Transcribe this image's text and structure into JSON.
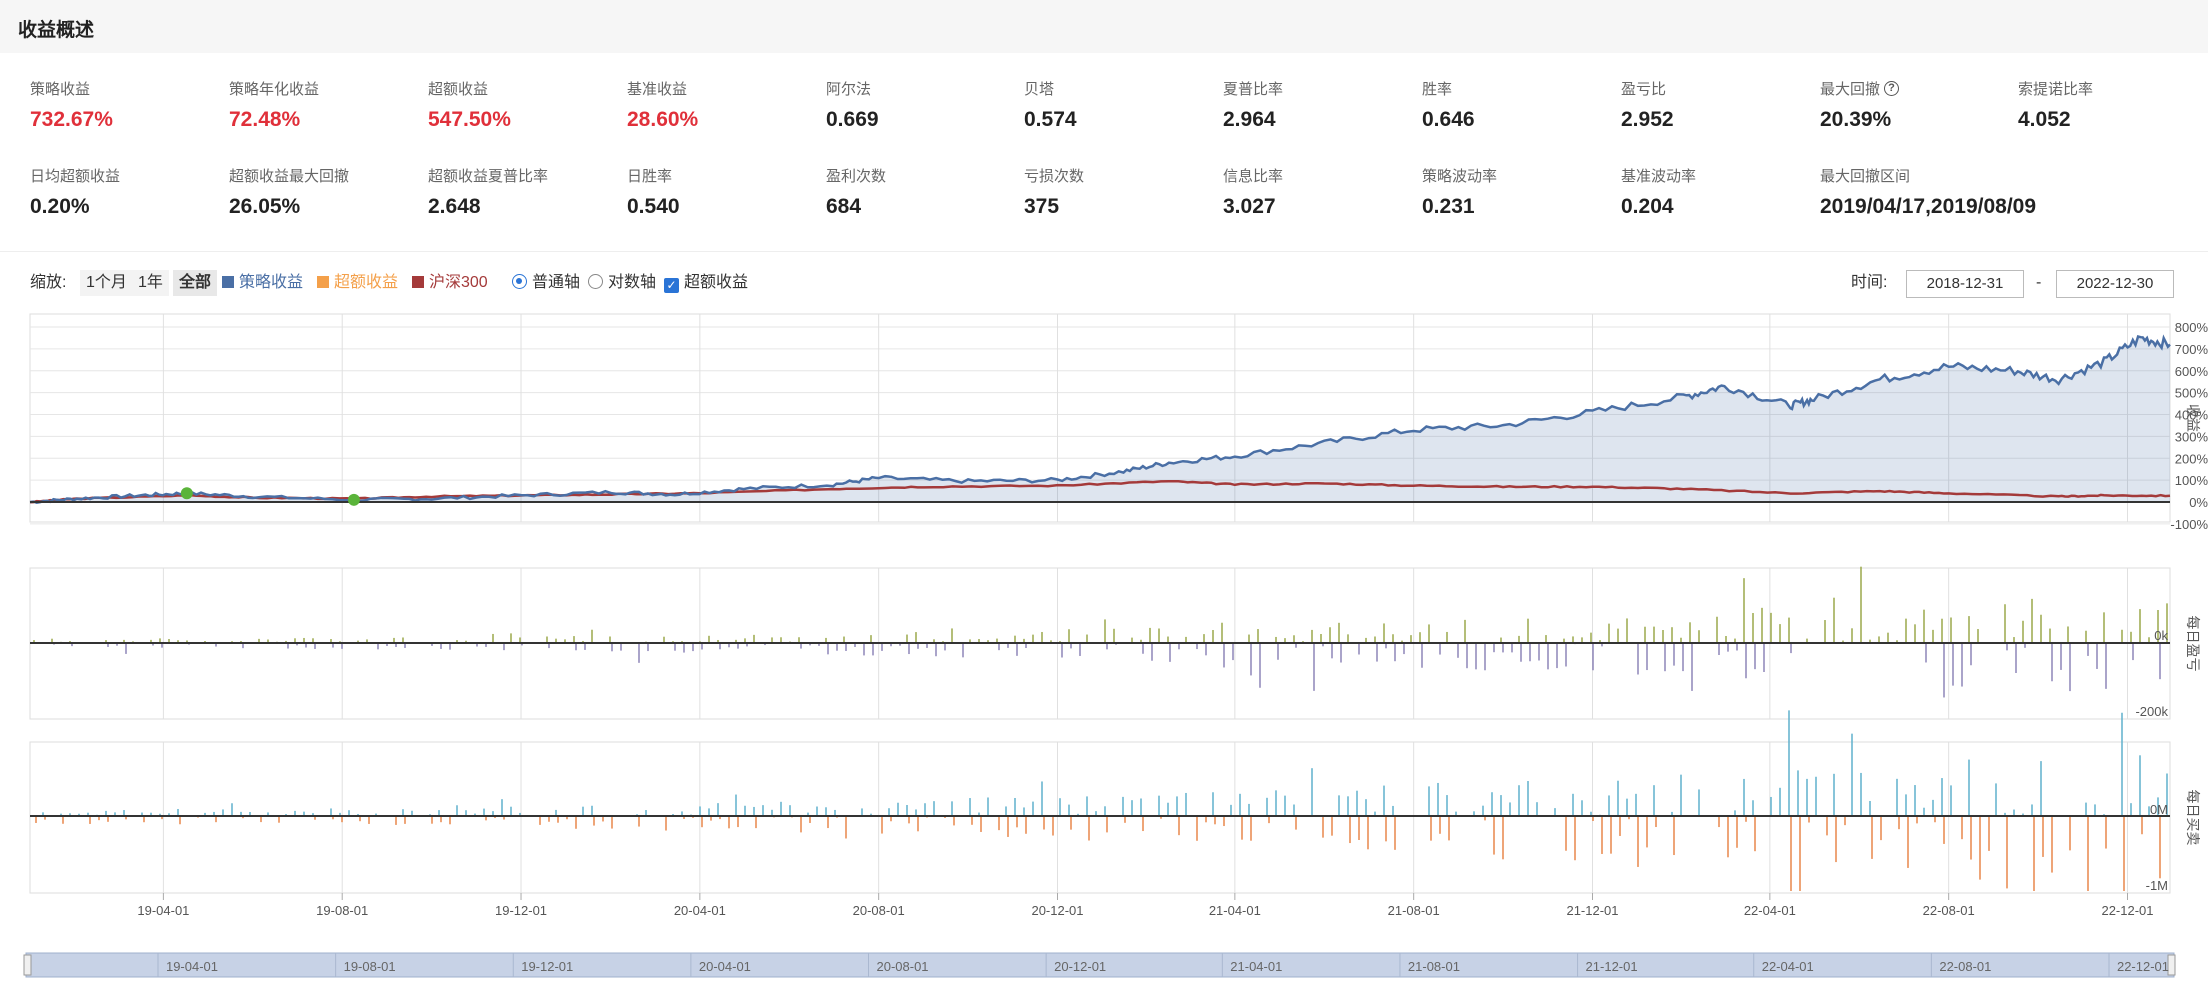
{
  "header": {
    "title": "收益概述"
  },
  "metrics_row1": [
    {
      "label": "策略收益",
      "value": "732.67%",
      "red": true
    },
    {
      "label": "策略年化收益",
      "value": "72.48%",
      "red": true
    },
    {
      "label": "超额收益",
      "value": "547.50%",
      "red": true
    },
    {
      "label": "基准收益",
      "value": "28.60%",
      "red": true
    },
    {
      "label": "阿尔法",
      "value": "0.669",
      "red": false
    },
    {
      "label": "贝塔",
      "value": "0.574",
      "red": false
    },
    {
      "label": "夏普比率",
      "value": "2.964",
      "red": false
    },
    {
      "label": "胜率",
      "value": "0.646",
      "red": false
    },
    {
      "label": "盈亏比",
      "value": "2.952",
      "red": false
    },
    {
      "label": "最大回撤",
      "value": "20.39%",
      "red": false,
      "help": true
    },
    {
      "label": "索提诺比率",
      "value": "4.052",
      "red": false
    }
  ],
  "metrics_row2": [
    {
      "label": "日均超额收益",
      "value": "0.20%"
    },
    {
      "label": "超额收益最大回撤",
      "value": "26.05%"
    },
    {
      "label": "超额收益夏普比率",
      "value": "2.648"
    },
    {
      "label": "日胜率",
      "value": "0.540"
    },
    {
      "label": "盈利次数",
      "value": "684"
    },
    {
      "label": "亏损次数",
      "value": "375"
    },
    {
      "label": "信息比率",
      "value": "3.027"
    },
    {
      "label": "策略波动率",
      "value": "0.231"
    },
    {
      "label": "基准波动率",
      "value": "0.204"
    },
    {
      "label": "最大回撤区间",
      "value": "2019/04/17,2019/08/09"
    }
  ],
  "help_glyph": "?",
  "toolbar": {
    "zoom_label": "缩放:",
    "zoom_1m": "1个月",
    "zoom_1y": "1年",
    "zoom_all": "全部",
    "legend_strategy": "策略收益",
    "legend_excess": "超额收益",
    "legend_benchmark": "沪深300",
    "axis_normal": "普通轴",
    "axis_log": "对数轴",
    "excess_checkbox": "超额收益",
    "check_glyph": "✓",
    "time_label": "时间:",
    "start_date": "2018-12-31",
    "date_sep": "-",
    "end_date": "2022-12-30"
  },
  "colors": {
    "strategy": "#4a6fa5",
    "excess": "#f4a04a",
    "benchmark": "#a43a3a",
    "profit_bar": "#9aa84a",
    "loss_bar": "#8e86b8",
    "buy_bar": "#5fb0cc",
    "sell_bar": "#e8874a",
    "marker": "#5ab43a"
  },
  "chart_data": [
    {
      "type": "area",
      "ylabel": "收益",
      "y_ticks": [
        "800%",
        "700%",
        "600%",
        "500%",
        "400%",
        "300%",
        "200%",
        "100%",
        "0%",
        "-100%"
      ],
      "ylim": [
        -100,
        800
      ],
      "x_ticks": [
        "19-04-01",
        "19-08-01",
        "19-12-01",
        "20-04-01",
        "20-08-01",
        "20-12-01",
        "21-04-01",
        "21-08-01",
        "21-12-01",
        "22-04-01",
        "22-08-01",
        "22-12-01"
      ],
      "x_range": [
        "2018-12-31",
        "2022-12-30"
      ],
      "series": [
        {
          "name": "策略收益",
          "x": [
            "2018-12-31",
            "2019-02-01",
            "2019-03-15",
            "2019-04-17",
            "2019-06-01",
            "2019-08-09",
            "2019-10-01",
            "2019-12-01",
            "2020-02-01",
            "2020-03-15",
            "2020-05-01",
            "2020-07-01",
            "2020-08-01",
            "2020-10-01",
            "2020-12-01",
            "2021-01-15",
            "2021-02-15",
            "2021-04-01",
            "2021-06-01",
            "2021-08-01",
            "2021-10-01",
            "2021-12-01",
            "2022-02-01",
            "2022-03-01",
            "2022-04-15",
            "2022-05-01",
            "2022-06-15",
            "2022-08-01",
            "2022-09-15",
            "2022-10-15",
            "2022-11-15",
            "2022-12-10",
            "2022-12-30"
          ],
          "y": [
            0,
            15,
            30,
            40,
            25,
            10,
            15,
            30,
            45,
            35,
            60,
            80,
            110,
            95,
            100,
            140,
            180,
            210,
            270,
            330,
            350,
            410,
            480,
            530,
            440,
            470,
            560,
            620,
            600,
            560,
            640,
            750,
            720
          ]
        },
        {
          "name": "沪深300",
          "x": [
            "2018-12-31",
            "2019-02-01",
            "2019-04-17",
            "2019-06-01",
            "2019-08-09",
            "2019-10-01",
            "2019-12-01",
            "2020-02-01",
            "2020-04-01",
            "2020-07-01",
            "2020-09-01",
            "2020-12-01",
            "2021-02-15",
            "2021-04-01",
            "2021-06-01",
            "2021-08-01",
            "2021-10-01",
            "2021-12-01",
            "2022-02-01",
            "2022-04-15",
            "2022-06-15",
            "2022-08-01",
            "2022-10-15",
            "2022-11-15",
            "2022-12-30"
          ],
          "y": [
            0,
            15,
            30,
            20,
            15,
            25,
            30,
            35,
            40,
            60,
            70,
            75,
            95,
            80,
            85,
            75,
            70,
            70,
            60,
            40,
            50,
            40,
            25,
            30,
            28.6
          ]
        }
      ],
      "markers": [
        {
          "x": "2019-04-17",
          "y": 40
        },
        {
          "x": "2019-08-09",
          "y": 10
        }
      ]
    },
    {
      "type": "bar",
      "ylabel": "每日盈亏",
      "y_ticks": [
        "0k",
        "-200k"
      ]
    },
    {
      "type": "bar",
      "ylabel": "每日买卖",
      "y_ticks": [
        "0M",
        "-1M"
      ]
    }
  ],
  "navigator_ticks": [
    "19-04-01",
    "19-08-01",
    "19-12-01",
    "20-04-01",
    "20-08-01",
    "20-12-01",
    "21-04-01",
    "21-08-01",
    "21-12-01",
    "22-04-01",
    "22-08-01",
    "22-12-01"
  ]
}
